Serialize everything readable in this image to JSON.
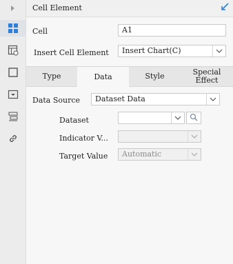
{
  "rail": {
    "items": [
      {
        "icon": "expand-arrow-icon"
      },
      {
        "icon": "cell-element-icon",
        "active": true
      },
      {
        "icon": "cell-attribute-icon"
      },
      {
        "icon": "border-icon"
      },
      {
        "icon": "widget-icon"
      },
      {
        "icon": "layer-icon"
      },
      {
        "icon": "hyperlink-icon"
      }
    ]
  },
  "header": {
    "title": "Cell Element"
  },
  "form": {
    "cell_label": "Cell",
    "cell_value": "A1",
    "insert_label": "Insert Cell Element",
    "insert_value": "Insert Chart(C)"
  },
  "tabs": [
    {
      "label": "Type"
    },
    {
      "label": "Data",
      "active": true
    },
    {
      "label": "Style"
    },
    {
      "label": "Special Effect"
    }
  ],
  "data_tab": {
    "data_source_label": "Data Source",
    "data_source_value": "Dataset Data",
    "dataset_label": "Dataset",
    "dataset_value": "",
    "indicator_label": "Indicator V...",
    "indicator_value": "",
    "target_label": "Target Value",
    "target_value": "Automatic"
  },
  "colors": {
    "accent": "#2f7fd6"
  }
}
